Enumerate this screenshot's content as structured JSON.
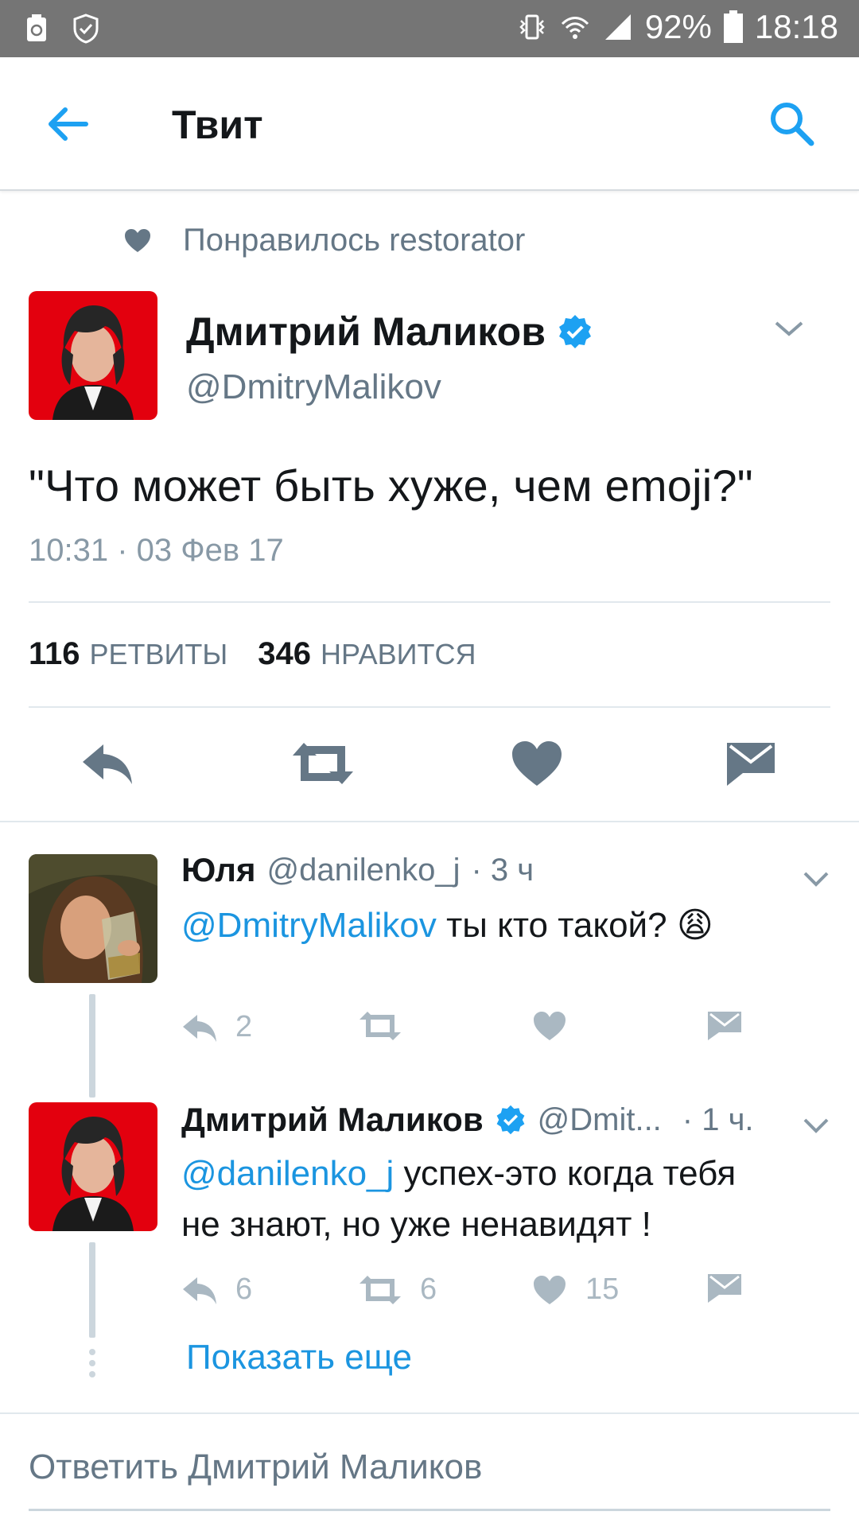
{
  "status_bar": {
    "battery": "92%",
    "time": "18:18",
    "icons": [
      "recycle-icon",
      "shield-icon",
      "vibrate-icon",
      "wifi-icon",
      "signal-icon",
      "battery-icon"
    ]
  },
  "app_bar": {
    "title": "Твит",
    "back_icon": "back-arrow-icon",
    "search_icon": "search-icon"
  },
  "social_context": {
    "icon": "heart-icon",
    "text": "Понравилось restorator"
  },
  "main_tweet": {
    "name": "Дмитрий Маликов",
    "handle": "@DmitryMalikov",
    "verified": true,
    "text": "\"Что может быть хуже, чем emoji?\"",
    "timestamp": "10:31 · 03 Фев 17",
    "retweets_count": "116",
    "retweets_label": "РЕТВИТЫ",
    "likes_count": "346",
    "likes_label": "НРАВИТСЯ",
    "actions": [
      "reply-icon",
      "retweet-icon",
      "heart-icon",
      "message-icon"
    ]
  },
  "replies": [
    {
      "name": "Юля",
      "handle": "@danilenko_j",
      "time": "· 3 ч",
      "mention": "@DmitryMalikov",
      "text": " ты кто такой? 😩",
      "reply_count": "2",
      "retweet_count": "",
      "like_count": ""
    },
    {
      "name": "Дмитрий Маликов",
      "handle": "@Dmit...",
      "time": "· 1 ч.",
      "verified": true,
      "mention": "@danilenko_j",
      "text_line1": " успех-это когда тебя",
      "text_line2": "не знают, но уже ненавидят !",
      "reply_count": "6",
      "retweet_count": "6",
      "like_count": "15"
    }
  ],
  "show_more": "Показать еще",
  "reply_input": {
    "placeholder": "Ответить Дмитрий Маликов"
  },
  "colors": {
    "accent": "#1b95e0",
    "status_bar": "#757575",
    "verified": "#1da1f2",
    "avatar_bg": "#e8000b"
  }
}
